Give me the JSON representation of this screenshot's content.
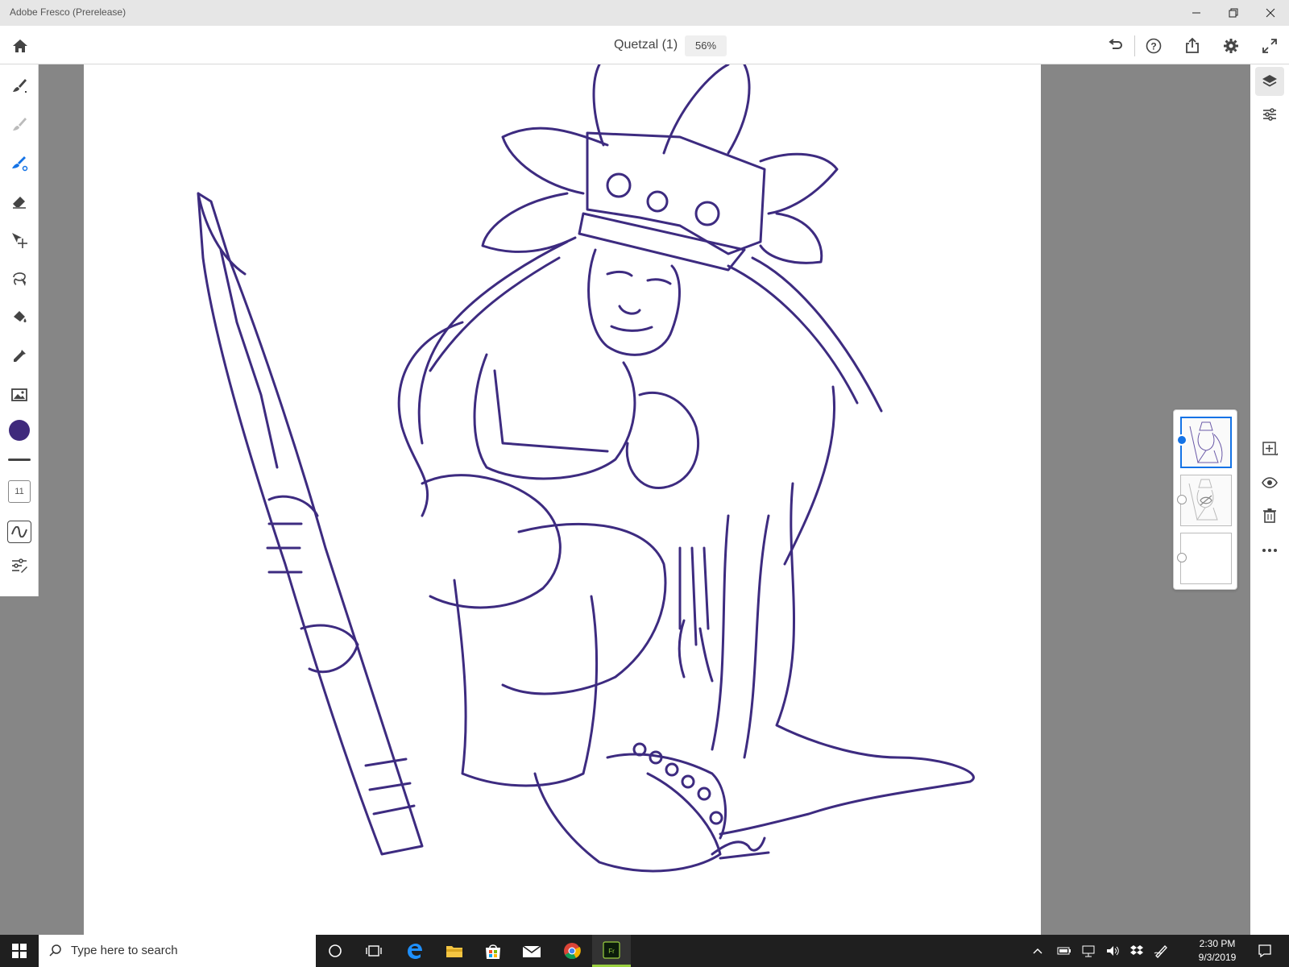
{
  "window": {
    "title": "Adobe Fresco (Prerelease)"
  },
  "header": {
    "document_name": "Quetzal (1)",
    "zoom": "56%"
  },
  "colors": {
    "brush_color": "#3f2a7c",
    "accent": "#1473e6",
    "line_art": "#3d2b80"
  },
  "left_toolbar": {
    "tools": [
      {
        "icon": "pixel-brush-icon"
      },
      {
        "icon": "live-brush-icon"
      },
      {
        "icon": "vector-brush-icon"
      },
      {
        "icon": "eraser-icon"
      },
      {
        "icon": "move-transform-icon"
      },
      {
        "icon": "lasso-selection-icon"
      },
      {
        "icon": "fill-bucket-icon"
      },
      {
        "icon": "eyedropper-icon"
      },
      {
        "icon": "place-image-icon"
      }
    ],
    "brush_size": "11"
  },
  "right_toolbar": {
    "tools": [
      {
        "icon": "layers-icon"
      },
      {
        "icon": "layer-properties-icon"
      },
      {
        "icon": "add-layer-icon"
      },
      {
        "icon": "visibility-eye-icon"
      },
      {
        "icon": "delete-layer-icon"
      },
      {
        "icon": "more-options-icon"
      }
    ]
  },
  "taskbar": {
    "search_placeholder": "Type here to search",
    "time": "2:30 PM",
    "date": "9/3/2019"
  }
}
